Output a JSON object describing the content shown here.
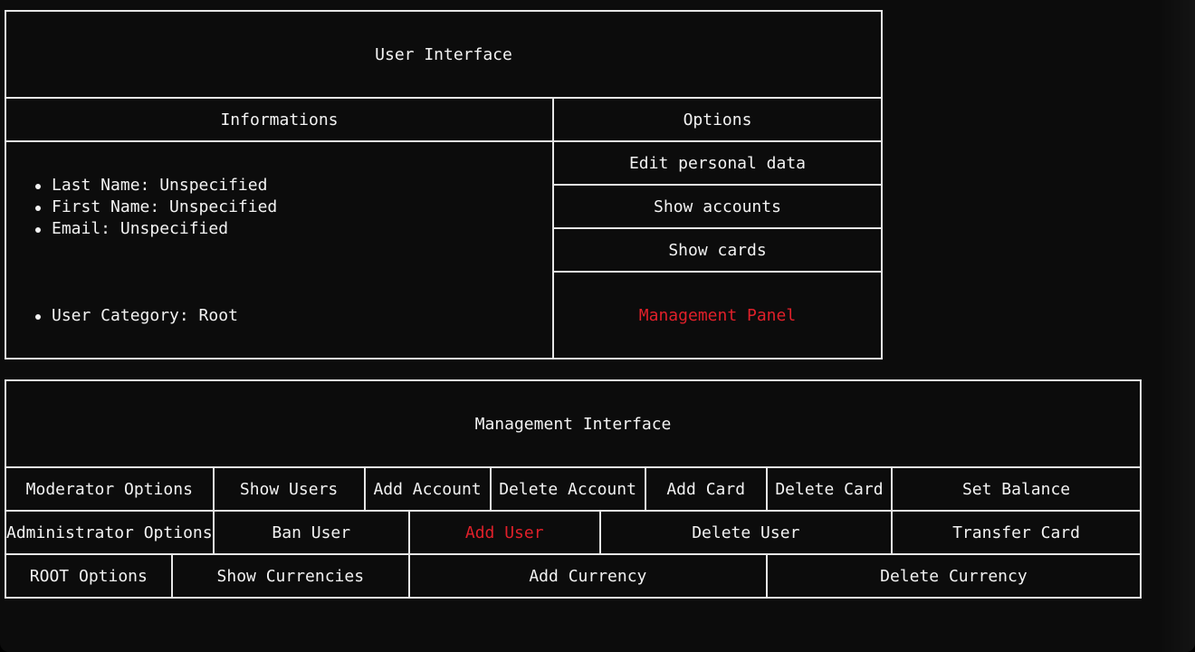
{
  "user_interface": {
    "title": "User Interface",
    "informations_header": "Informations",
    "options_header": "Options",
    "info_items": [
      "Last Name: Unspecified",
      "First Name: Unspecified",
      "Email: Unspecified"
    ],
    "category_item": "User Category: Root",
    "options": {
      "edit_personal_data": "Edit personal data",
      "show_accounts": "Show accounts",
      "show_cards": "Show cards",
      "management_panel": "Management Panel"
    }
  },
  "management_interface": {
    "title": "Management Interface",
    "moderator": {
      "label": "Moderator Options",
      "show_users": "Show Users",
      "add_account": "Add Account",
      "delete_account": "Delete Account",
      "add_card": "Add Card",
      "delete_card": "Delete Card",
      "set_balance": "Set Balance"
    },
    "administrator": {
      "label": "Administrator Options",
      "ban_user": "Ban User",
      "add_user": "Add User",
      "delete_user": "Delete User",
      "transfer_card": "Transfer Card"
    },
    "root": {
      "label": "ROOT Options",
      "show_currencies": "Show Currencies",
      "add_currency": "Add Currency",
      "delete_currency": "Delete Currency"
    }
  },
  "colors": {
    "background": "#0c0c0c",
    "text": "#f2f2f2",
    "border": "#e6e6e6",
    "highlight": "#e0202a"
  }
}
